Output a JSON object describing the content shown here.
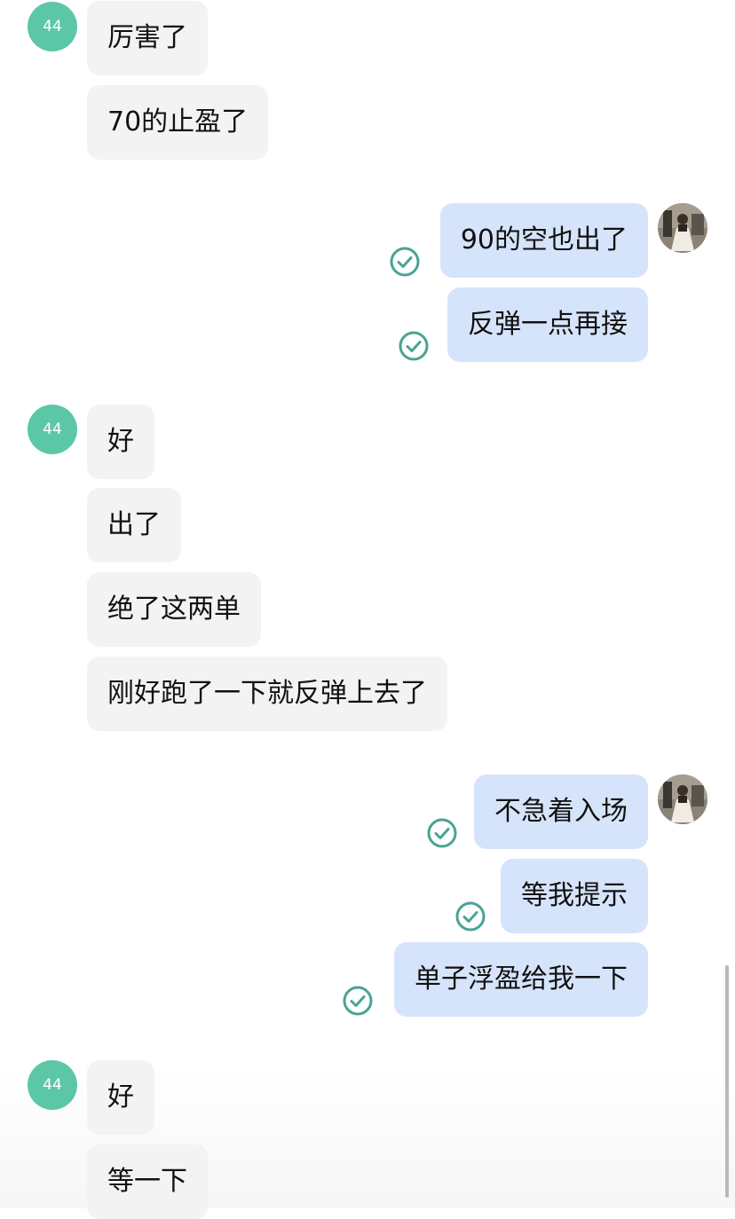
{
  "colors": {
    "incoming_bubble": "#f3f3f3",
    "outgoing_bubble": "#d6e4fb",
    "avatar_bg": "#5cc7a6",
    "check_color": "#4aa392"
  },
  "contact": {
    "avatar_label": "44"
  },
  "icons": {
    "read_receipt": "check-circle-icon",
    "self_avatar": "profile-photo"
  },
  "messages": [
    {
      "side": "in",
      "text": "厉害了"
    },
    {
      "side": "in",
      "text": "70的止盈了"
    },
    {
      "side": "out",
      "text": "90的空也出了",
      "read": true
    },
    {
      "side": "out",
      "text": "反弹一点再接",
      "read": true
    },
    {
      "side": "in",
      "text": "好"
    },
    {
      "side": "in",
      "text": "出了"
    },
    {
      "side": "in",
      "text": "绝了这两单"
    },
    {
      "side": "in",
      "text": "刚好跑了一下就反弹上去了"
    },
    {
      "side": "out",
      "text": "不急着入场",
      "read": true
    },
    {
      "side": "out",
      "text": "等我提示",
      "read": true
    },
    {
      "side": "out",
      "text": "单子浮盈给我一下",
      "read": true
    },
    {
      "side": "in",
      "text": "好"
    },
    {
      "side": "in",
      "text": "等一下"
    }
  ]
}
